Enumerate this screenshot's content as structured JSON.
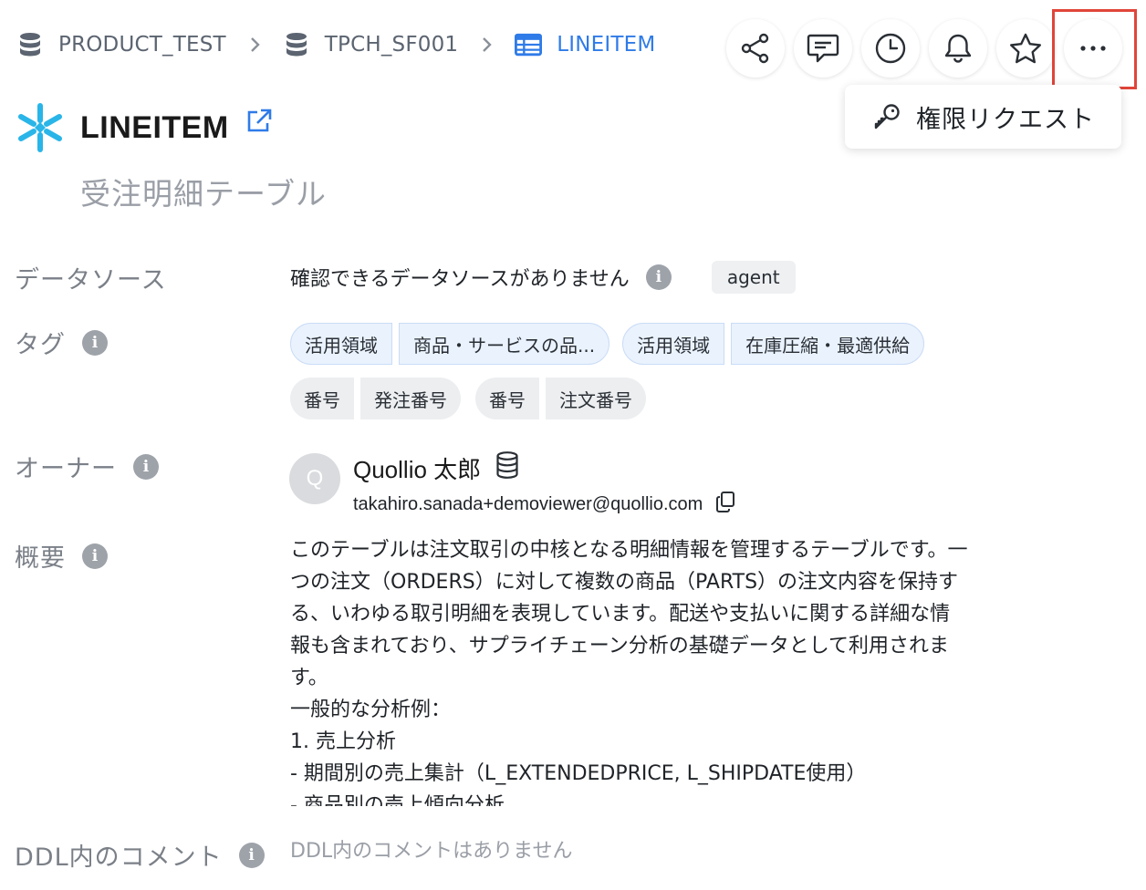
{
  "breadcrumb": [
    {
      "label": "PRODUCT_TEST",
      "icon": "database-icon"
    },
    {
      "label": "TPCH_SF001",
      "icon": "schema-icon"
    },
    {
      "label": "LINEITEM",
      "icon": "table-icon"
    }
  ],
  "toolbar": {
    "buttons": [
      "share-icon",
      "comment-icon",
      "history-icon",
      "bell-icon",
      "star-icon",
      "more-icon"
    ]
  },
  "menu": {
    "request_permission": "権限リクエスト"
  },
  "table": {
    "name": "LINEITEM",
    "subtitle": "受注明細テーブル",
    "brand_color": "#29b5e8"
  },
  "fields": {
    "datasource_label": "データソース",
    "datasource_value": "確認できるデータソースがありません",
    "datasource_badge": "agent",
    "tags_label": "タグ",
    "owner_label": "オーナー",
    "summary_label": "概要",
    "ddl_label": "DDL内のコメント",
    "ddl_value": "DDL内のコメントはありません"
  },
  "tags": [
    {
      "parts": [
        "活用領域",
        "商品・サービスの品..."
      ],
      "style": "blue"
    },
    {
      "parts": [
        "活用領域",
        "在庫圧縮・最適供給"
      ],
      "style": "blue"
    },
    {
      "parts": [
        "番号",
        "発注番号"
      ],
      "style": "gray"
    },
    {
      "parts": [
        "番号",
        "注文番号"
      ],
      "style": "gray"
    }
  ],
  "owner": {
    "initial": "Q",
    "name": "Quollio 太郎",
    "email": "takahiro.sanada+demoviewer@quollio.com"
  },
  "summary_lines": [
    "このテーブルは注文取引の中核となる明細情報を管理するテーブルです。一",
    "つの注文（ORDERS）に対して複数の商品（PARTS）の注文内容を保持す",
    "る、いわゆる取引明細を表現しています。配送や支払いに関する詳細な情",
    "報も含まれており、サプライチェーン分析の基礎データとして利用されま",
    "す。",
    "一般的な分析例：",
    "1. 売上分析",
    "- 期間別の売上集計（L_EXTENDEDPRICE, L_SHIPDATE使用）",
    "- 商品別の売上傾向分析"
  ],
  "colors": {
    "accent": "#2f7be8",
    "highlight": "#e0453a"
  }
}
